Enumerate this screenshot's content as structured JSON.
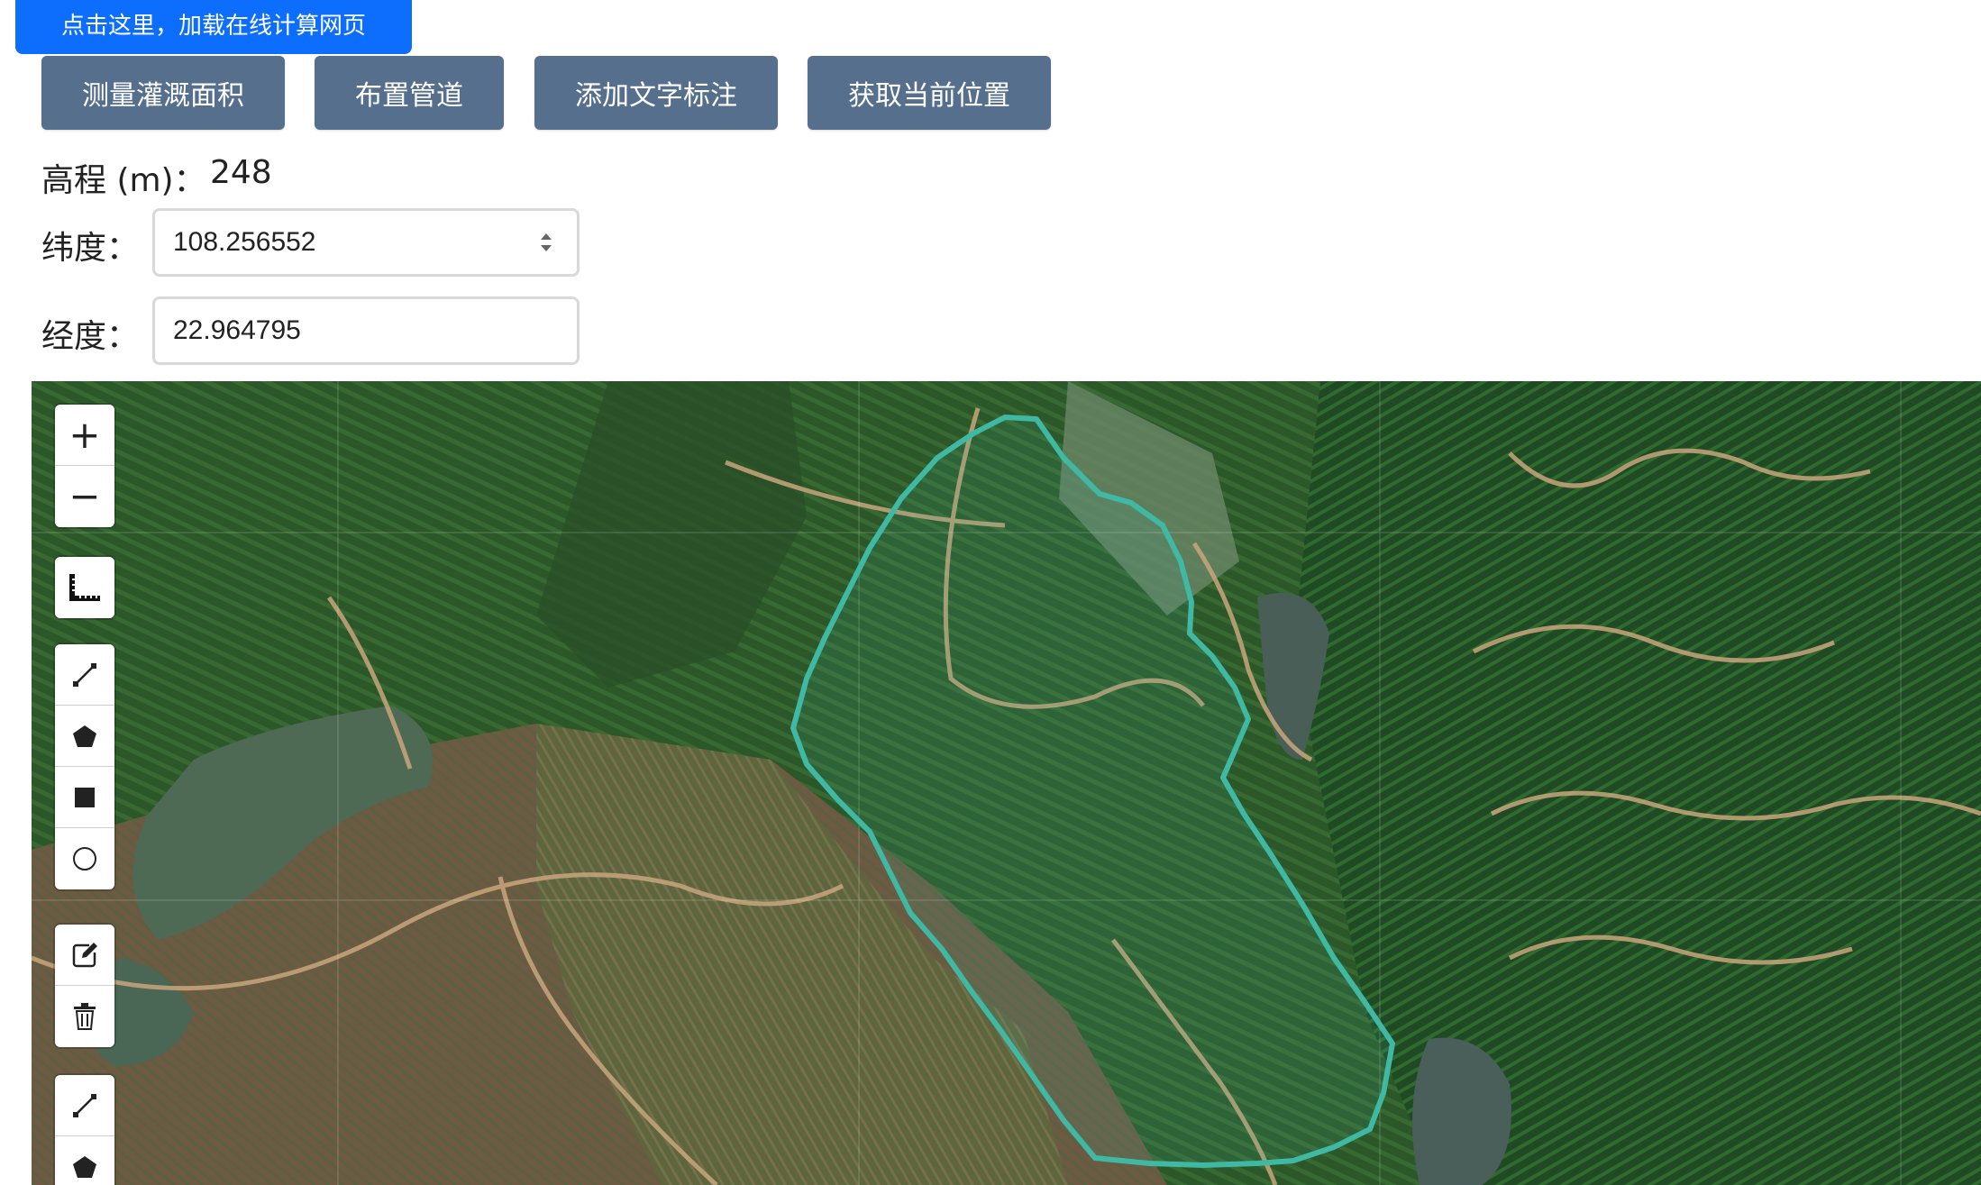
{
  "banner": {
    "label": "点击这里，加载在线计算网页"
  },
  "toolbar": {
    "measure_area": "测量灌溉面积",
    "place_pipe": "布置管道",
    "add_text": "添加文字标注",
    "get_location": "获取当前位置"
  },
  "elevation": {
    "label": "高程 (m)：",
    "value": "248"
  },
  "latitude": {
    "label": "纬度：",
    "value": "108.256552"
  },
  "longitude": {
    "label": "经度：",
    "value": "22.964795"
  },
  "map_controls": {
    "zoom": [
      "zoom-in-icon",
      "zoom-out-icon"
    ],
    "measure": [
      "ruler-icon"
    ],
    "draw": [
      "polyline-icon",
      "polygon-icon",
      "rectangle-icon",
      "circle-icon"
    ],
    "edit": [
      "edit-icon",
      "trash-icon"
    ],
    "draw2": [
      "polyline-icon",
      "polygon-icon"
    ]
  },
  "colors": {
    "banner": "#0d6efd",
    "toolbar_button": "#556f8d",
    "polygon_stroke": "#3fb8a4"
  }
}
